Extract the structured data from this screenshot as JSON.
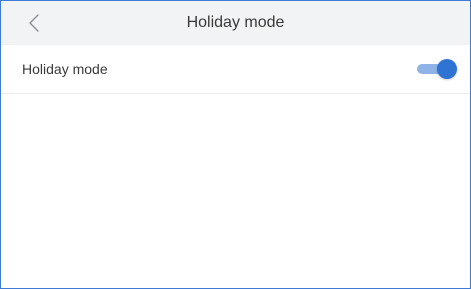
{
  "header": {
    "title": "Holiday mode",
    "back_icon": "chevron-left-icon"
  },
  "settings": {
    "holiday_mode": {
      "label": "Holiday mode",
      "enabled": true
    }
  },
  "colors": {
    "accent": "#2f73d3",
    "track_on": "#8fb3e6",
    "header_bg": "#f2f3f5",
    "frame_border": "#3f7ad6"
  }
}
